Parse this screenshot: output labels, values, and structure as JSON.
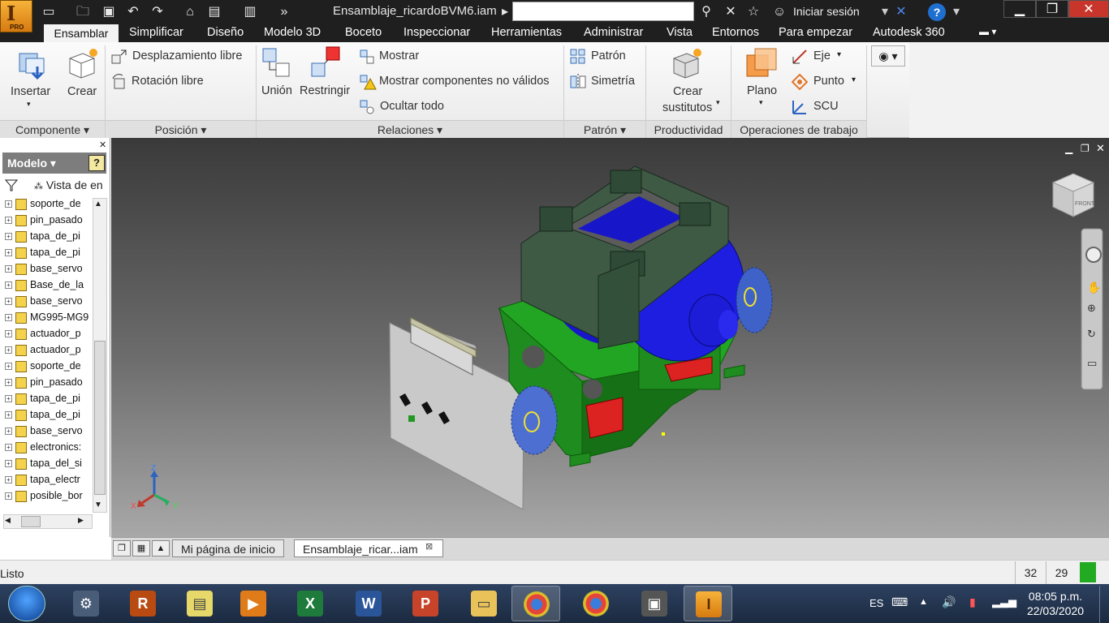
{
  "app": {
    "logo_letter": "I",
    "logo_edition": "PRO",
    "document_title": "Ensamblaje_ricardoBVM6.iam",
    "sign_in": "Iniciar sesión",
    "help": "?"
  },
  "menu_tabs": [
    "Ensamblar",
    "Simplificar",
    "Diseño",
    "Modelo 3D",
    "Boceto",
    "Inspeccionar",
    "Herramientas",
    "Administrar",
    "Vista",
    "Entornos",
    "Para empezar",
    "Autodesk 360"
  ],
  "ribbon": {
    "componente": {
      "insertar": "Insertar",
      "crear": "Crear",
      "panel": "Componente"
    },
    "posicion": {
      "desplazamiento": "Desplazamiento libre",
      "rotacion": "Rotación libre",
      "panel": "Posición"
    },
    "relaciones": {
      "union": "Unión",
      "restringir": "Restringir",
      "mostrar": "Mostrar",
      "mostrar_no_validos": "Mostrar componentes no válidos",
      "ocultar_todo": "Ocultar todo",
      "panel": "Relaciones"
    },
    "patron": {
      "patron": "Patrón",
      "simetria": "Simetría",
      "panel": "Patrón"
    },
    "productividad": {
      "crear_sustitutos_1": "Crear",
      "crear_sustitutos_2": "sustitutos",
      "panel": "Productividad"
    },
    "operaciones": {
      "plano": "Plano",
      "eje": "Eje",
      "punto": "Punto",
      "scu": "SCU",
      "panel": "Operaciones de trabajo"
    }
  },
  "browser": {
    "header": "Modelo",
    "view_label": "Vista de en",
    "items": [
      "soporte_de",
      "pin_pasado",
      "tapa_de_pi",
      "tapa_de_pi",
      "base_servo",
      "Base_de_la",
      "base_servo",
      "MG995-MG9",
      "actuador_p",
      "actuador_p",
      "soporte_de",
      "pin_pasado",
      "tapa_de_pi",
      "tapa_de_pi",
      "base_servo",
      "electronics:",
      "tapa_del_si",
      "tapa_electr",
      "posible_bor"
    ]
  },
  "viewcube": {
    "face_label": "FRONT"
  },
  "axes": {
    "z": "Z",
    "x": "X",
    "y": "Y"
  },
  "doc_tabs": [
    "Mi página de inicio",
    "Ensamblaje_ricar...iam"
  ],
  "status": {
    "text": "Listo",
    "count1": "32",
    "count2": "29"
  },
  "taskbar": {
    "lang": "ES",
    "time": "08:05 p.m.",
    "date": "22/03/2020"
  },
  "colors": {
    "accent": "#1f6fd1",
    "model_green": "#1e9a1e",
    "model_blue": "#1a1adf",
    "model_red": "#d42222",
    "dark_frame": "#3f5a46"
  }
}
